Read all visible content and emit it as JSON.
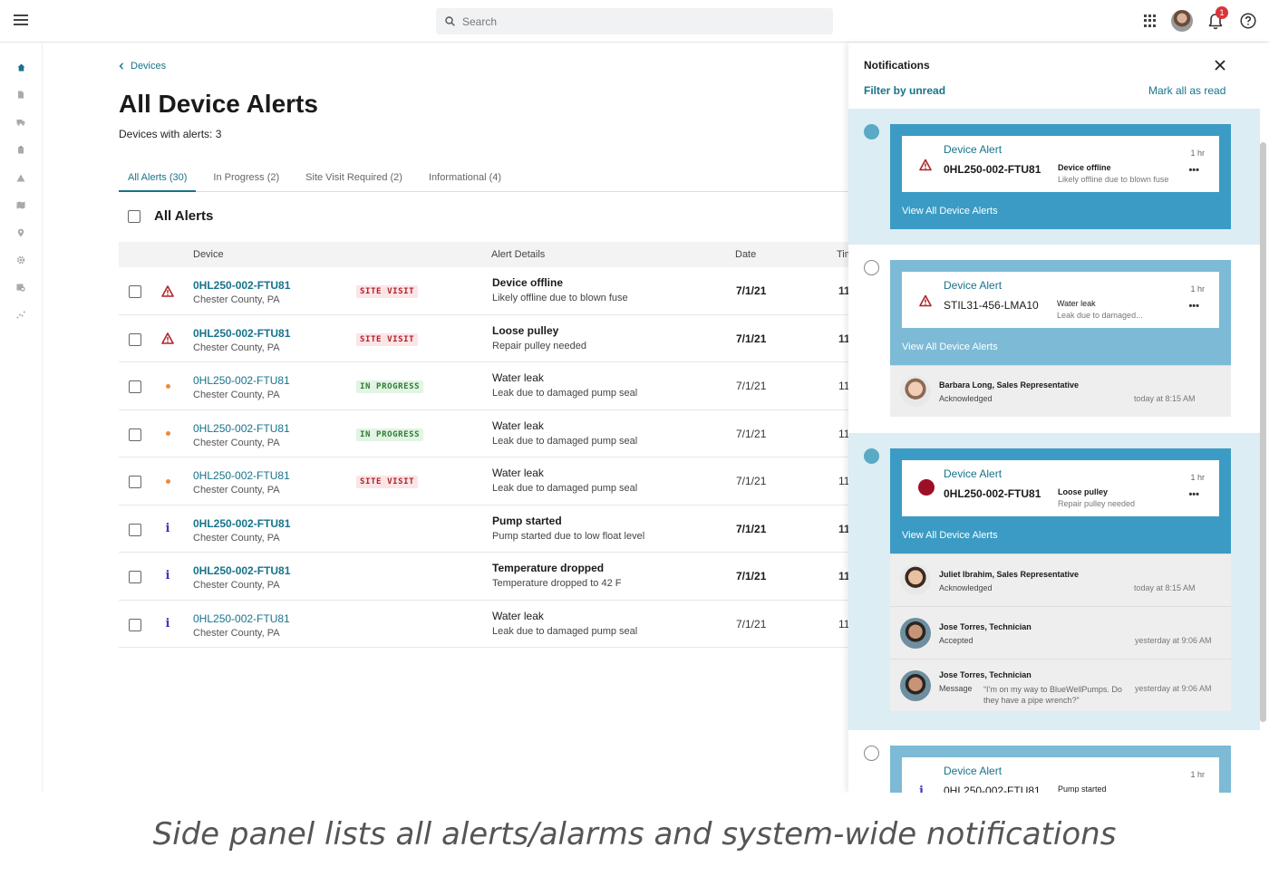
{
  "search": {
    "placeholder": "Search"
  },
  "header": {
    "notification_count": "1"
  },
  "breadcrumb": {
    "label": "Devices"
  },
  "page": {
    "title": "All Device Alerts",
    "subtitle": "Devices with alerts: 3"
  },
  "tabs": [
    {
      "label": "All Alerts (30)"
    },
    {
      "label": "In Progress (2)"
    },
    {
      "label": "Site Visit Required (2)"
    },
    {
      "label": "Informational (4)"
    }
  ],
  "list": {
    "heading": "All Alerts"
  },
  "table": {
    "columns": {
      "device": "Device",
      "alert_details": "Alert Details",
      "date": "Date",
      "time": "Tim"
    },
    "rows": [
      {
        "device": "0HL250-002-FTU81",
        "location": "Chester County, PA",
        "tag": "SITE VISIT",
        "title": "Device offline",
        "detail": "Likely offline due to blown fuse",
        "date": "7/1/21",
        "time": "11"
      },
      {
        "device": "0HL250-002-FTU81",
        "location": "Chester County, PA",
        "tag": "SITE VISIT",
        "title": "Loose pulley",
        "detail": "Repair pulley needed",
        "date": "7/1/21",
        "time": "11"
      },
      {
        "device": "0HL250-002-FTU81",
        "location": "Chester County, PA",
        "tag": "IN PROGRESS",
        "title": "Water leak",
        "detail": "Leak due to damaged pump seal",
        "date": "7/1/21",
        "time": "11"
      },
      {
        "device": "0HL250-002-FTU81",
        "location": "Chester County, PA",
        "tag": "IN PROGRESS",
        "title": "Water leak",
        "detail": "Leak due to damaged pump seal",
        "date": "7/1/21",
        "time": "11"
      },
      {
        "device": "0HL250-002-FTU81",
        "location": "Chester County, PA",
        "tag": "SITE VISIT",
        "title": "Water leak",
        "detail": "Leak due to damaged pump seal",
        "date": "7/1/21",
        "time": "11"
      },
      {
        "device": "0HL250-002-FTU81",
        "location": "Chester County, PA",
        "tag": "",
        "title": "Pump started",
        "detail": "Pump started due to low float level",
        "date": "7/1/21",
        "time": "11"
      },
      {
        "device": "0HL250-002-FTU81",
        "location": "Chester County, PA",
        "tag": "",
        "title": "Temperature dropped",
        "detail": "Temperature dropped to 42 F",
        "date": "7/1/21",
        "time": "11"
      },
      {
        "device": "0HL250-002-FTU81",
        "location": "Chester County, PA",
        "tag": "",
        "title": "Water leak",
        "detail": "Leak due to damaged pump seal",
        "date": "7/1/21",
        "time": "11"
      }
    ]
  },
  "notifications": {
    "title": "Notifications",
    "filter_label": "Filter by unread",
    "mark_all_label": "Mark all as read",
    "items": [
      {
        "type": "Device Alert",
        "ago": "1 hr",
        "device": "0HL250-002-FTU81",
        "message": "Device offline",
        "detail": "Likely offline due to blown fuse",
        "link": "View All Device Alerts"
      },
      {
        "type": "Device Alert",
        "ago": "1 hr",
        "device": "STIL31-456-LMA10",
        "message": "Water leak",
        "detail": "Leak due to damaged...",
        "link": "View All Device Alerts",
        "activity": [
          {
            "who": "Barbara Long, Sales Representative",
            "what": "Acknowledged",
            "when": "today at 8:15 AM"
          }
        ]
      },
      {
        "type": "Device Alert",
        "ago": "1 hr",
        "device": "0HL250-002-FTU81",
        "message": "Loose pulley",
        "detail": "Repair pulley needed",
        "link": "View All Device Alerts",
        "activity": [
          {
            "who": "Juliet Ibrahim, Sales Representative",
            "what": "Acknowledged",
            "when": "today at 8:15 AM"
          },
          {
            "who": "Jose Torres, Technician",
            "what": "Accepted",
            "when": "yesterday at 9:06 AM"
          },
          {
            "who": "Jose Torres, Technician",
            "what": "Message",
            "quote": "“I’m on my way to BlueWellPumps. Do they have a  pipe wrench?”",
            "when": "yesterday at 9:06 AM"
          }
        ]
      },
      {
        "type": "Device Alert",
        "ago": "1 hr",
        "device": "0HL250-002-FTU81",
        "message": "Pump started"
      }
    ]
  },
  "caption": "Side panel lists all alerts/alarms and system-wide notifications",
  "colors": {
    "accent": "#17738a",
    "alert_blue": "#3b9bc4",
    "unread_bg": "#dcedf3",
    "danger": "#b0222a"
  }
}
